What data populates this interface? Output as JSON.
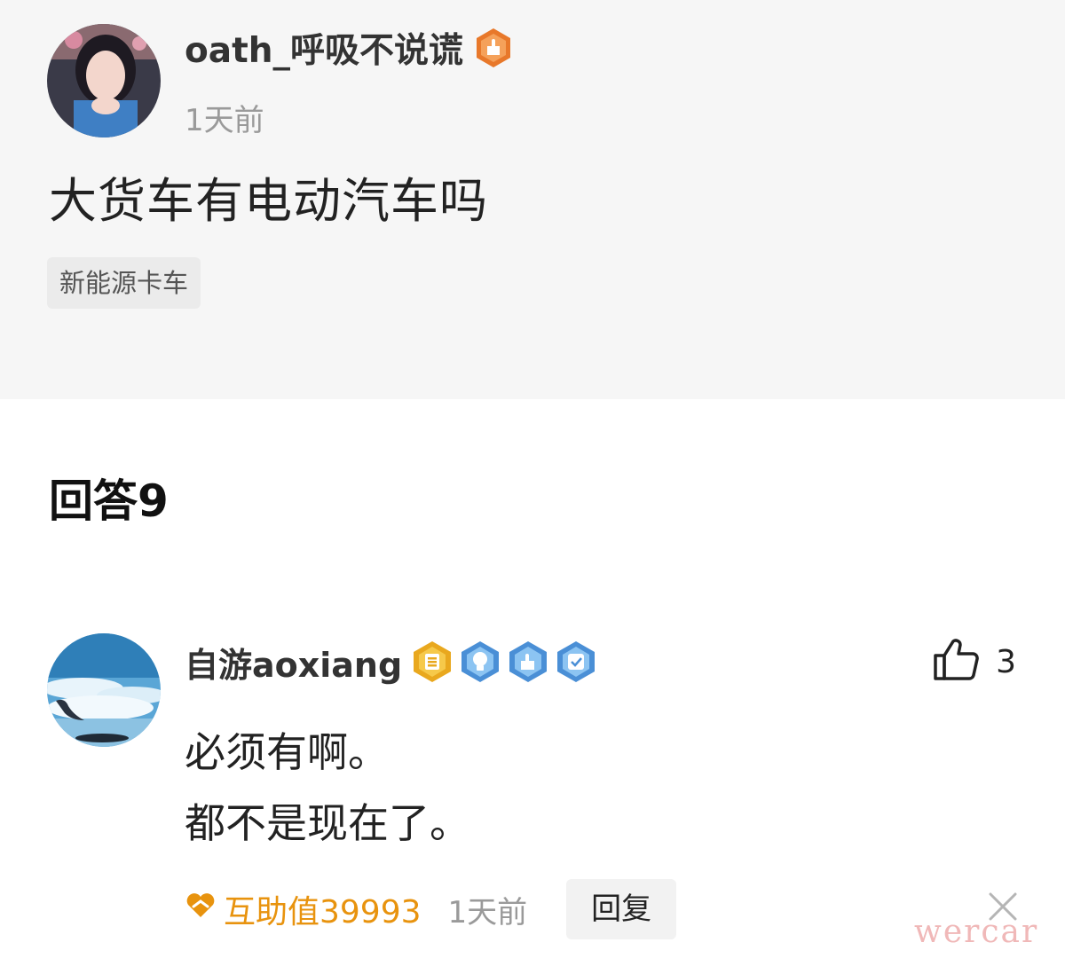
{
  "question": {
    "author_name": "oath_呼吸不说谎",
    "time": "1天前",
    "title": "大货车有电动汽车吗",
    "tag": "新能源卡车"
  },
  "answers_header": "回答9",
  "answer": {
    "author_name": "自游aoxiang",
    "likes": "3",
    "body_lines": [
      "必须有啊。",
      "都不是现在了。"
    ],
    "help_value": "互助值39993",
    "time": "1天前",
    "reply_label": "回复"
  },
  "watermark": "wercar",
  "colors": {
    "question_bg": "#f6f6f6",
    "accent_orange": "#e8930e",
    "badge_blue": "#4a8fd6",
    "muted_text": "#9a9a9a"
  },
  "icons": {
    "question_author_badge": "orange-fist-badge-icon",
    "answer_badges": [
      "gold-level-badge-icon",
      "blue-bulb-badge-icon",
      "blue-fist-badge-icon",
      "blue-check-badge-icon"
    ],
    "like": "thumbs-up-icon",
    "help": "heart-hands-icon",
    "close": "close-icon"
  }
}
